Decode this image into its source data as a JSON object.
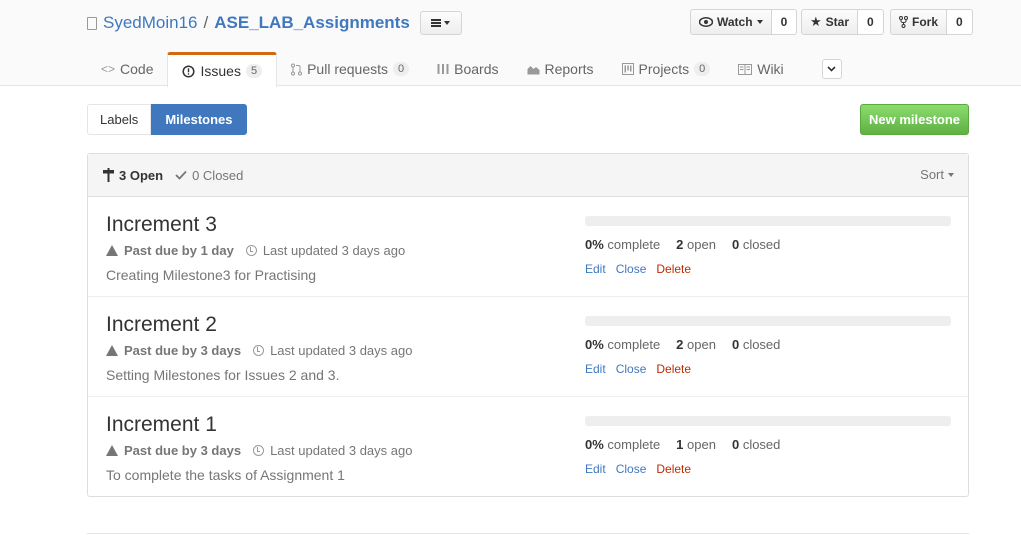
{
  "repo": {
    "owner": "SyedMoin16",
    "separator": "/",
    "name": "ASE_LAB_Assignments"
  },
  "social": {
    "watch_label": "Watch",
    "watch_count": "0",
    "star_label": "Star",
    "star_count": "0",
    "fork_label": "Fork",
    "fork_count": "0"
  },
  "tabs": [
    {
      "label": "Code",
      "count": ""
    },
    {
      "label": "Issues",
      "count": "5"
    },
    {
      "label": "Pull requests",
      "count": "0"
    },
    {
      "label": "Boards",
      "count": ""
    },
    {
      "label": "Reports",
      "count": ""
    },
    {
      "label": "Projects",
      "count": "0"
    },
    {
      "label": "Wiki",
      "count": ""
    }
  ],
  "subnav": {
    "labels": "Labels",
    "milestones": "Milestones",
    "new_milestone": "New milestone"
  },
  "filters": {
    "open": "3 Open",
    "closed": "0 Closed",
    "sort": "Sort"
  },
  "milestones": [
    {
      "title": "Increment 3",
      "due": "Past due by 1 day",
      "updated": "Last updated 3 days ago",
      "description": "Creating Milestone3 for Practising",
      "percent": "0%",
      "complete_label": "complete",
      "open_count": "2",
      "open_label": "open",
      "closed_count": "0",
      "closed_label": "closed",
      "progress": 0
    },
    {
      "title": "Increment 2",
      "due": "Past due by 3 days",
      "updated": "Last updated 3 days ago",
      "description": "Setting Milestones for Issues 2 and 3.",
      "percent": "0%",
      "complete_label": "complete",
      "open_count": "2",
      "open_label": "open",
      "closed_count": "0",
      "closed_label": "closed",
      "progress": 0
    },
    {
      "title": "Increment 1",
      "due": "Past due by 3 days",
      "updated": "Last updated 3 days ago",
      "description": "To complete the tasks of Assignment 1",
      "percent": "0%",
      "complete_label": "complete",
      "open_count": "1",
      "open_label": "open",
      "closed_count": "0",
      "closed_label": "closed",
      "progress": 0
    }
  ],
  "actions": {
    "edit": "Edit",
    "close": "Close",
    "delete": "Delete"
  }
}
